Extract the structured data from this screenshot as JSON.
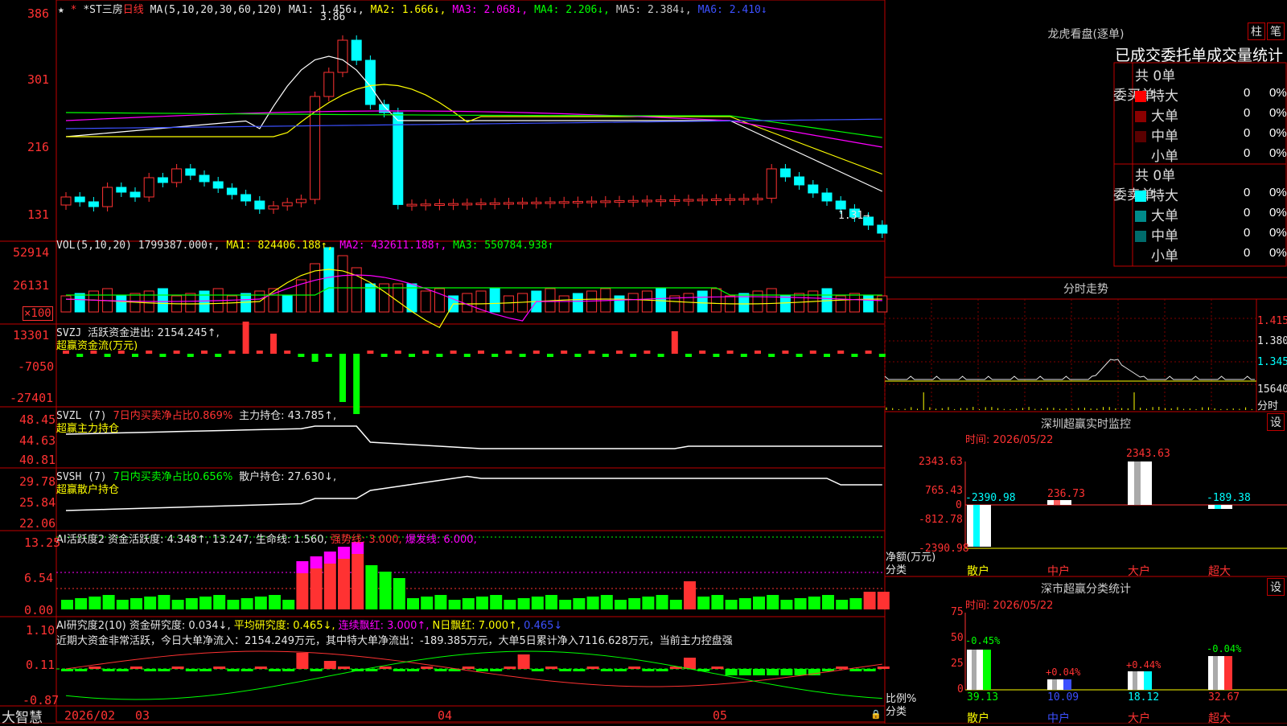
{
  "kline": {
    "stock": "*ST三房",
    "period": "日线",
    "ma_params": "MA(5,10,20,30,60,120)",
    "ma_values": [
      "MA1: 1.456↓,",
      "MA2: 1.666↓,",
      "MA3: 2.068↓,",
      "MA4: 2.206↓,",
      "MA5: 2.384↓,",
      "MA6: 2.410↓"
    ],
    "y_ticks": [
      "386",
      "301",
      "216",
      "131"
    ],
    "high_label": "3.86",
    "last_label": "1.31→"
  },
  "vol": {
    "head": [
      "VOL(5,10,20)",
      "1799387.000↑,",
      "MA1: 824406.188↑,",
      "MA2: 432611.188↑,",
      "MA3: 550784.938↑"
    ],
    "y_ticks": [
      "52914",
      "26131",
      "×100"
    ]
  },
  "svzj": {
    "head": [
      "SVZJ",
      "活跃资金进出: 2154.245↑,"
    ],
    "sub": "超赢资金流(万元)",
    "y_ticks": [
      "13301",
      "-7050",
      "-27401"
    ]
  },
  "svzl": {
    "head": [
      "SVZL (7)",
      "7日内买卖净占比0.869%",
      "主力持仓: 43.785↑,"
    ],
    "sub": "超赢主力持仓",
    "y_ticks": [
      "48.45",
      "44.63",
      "40.81"
    ]
  },
  "svsh": {
    "head": [
      "SVSH (7)",
      "7日内买卖净占比0.656%",
      "散户持仓: 27.630↓,"
    ],
    "sub": "超赢散户持仓",
    "y_ticks": [
      "29.78",
      "25.84",
      "22.06"
    ]
  },
  "ai1": {
    "head": [
      "AI活跃度2",
      "资金活跃度: 4.348↑,",
      "13.247,",
      "生命线: 1.560,",
      "强势线: 3.000,",
      "爆发线: 6.000,"
    ],
    "y_ticks": [
      "13.25",
      "6.54",
      "0.00"
    ]
  },
  "ai2": {
    "head": [
      "AI研究度2(10)",
      "资金研究度: 0.034↓,",
      "平均研究度: 0.465↓,",
      "连续飘红: 3.000↑,",
      "N日飘红: 7.000↑,",
      "0.465↓"
    ],
    "comment": "近期大资金非常活跃，今日大单净流入：2154.249万元，其中特大单净流出：-189.385万元，大单5日累计净入7116.628万元，当前主力控盘强",
    "y_ticks": [
      "1.10",
      "0.11",
      "-0.87"
    ]
  },
  "xaxis": {
    "brand": "大智慧",
    "labels": [
      "2026/02",
      "03",
      "04",
      "05"
    ]
  },
  "longhu": {
    "title": "龙虎看盘(逐单)",
    "btn1": "柱",
    "btn2": "笔",
    "subtitle": "已成交委托单成交量统计",
    "buy_side": "委买单",
    "sell_side": "委卖单",
    "buy_total": "共 0单",
    "sell_total": "共 0单",
    "buy_rows": [
      {
        "name": "特大",
        "count": "0",
        "pct": "0%",
        "color": "#ff0000"
      },
      {
        "name": "大单",
        "count": "0",
        "pct": "0%",
        "color": "#8b0000"
      },
      {
        "name": "中单",
        "count": "0",
        "pct": "0%",
        "color": "#5a0000"
      },
      {
        "name": "小单",
        "count": "0",
        "pct": "0%",
        "color": ""
      }
    ],
    "sell_rows": [
      {
        "name": "特大",
        "count": "0",
        "pct": "0%",
        "color": "#00ffff"
      },
      {
        "name": "大单",
        "count": "0",
        "pct": "0%",
        "color": "#008b8b"
      },
      {
        "name": "中单",
        "count": "0",
        "pct": "0%",
        "color": "#006b6b"
      },
      {
        "name": "小单",
        "count": "0",
        "pct": "0%",
        "color": ""
      }
    ]
  },
  "fenshi": {
    "title": "分时走势",
    "y_ticks": [
      "1.415",
      "1.380",
      "1.345"
    ],
    "vol_label": "15640",
    "foot": "分时"
  },
  "monitor": {
    "title": "深圳超赢实时监控",
    "btn": "设",
    "time": "时间: 2026/05/22",
    "y_ticks": [
      "2343.63",
      "765.43",
      "0",
      "-812.78",
      "-2390.98"
    ],
    "unit": "净额(万元)",
    "cat_label": "分类",
    "categories": [
      "散户",
      "中户",
      "大户",
      "超大"
    ],
    "values": [
      "-2390.98",
      "236.73",
      "2343.63",
      "-189.38"
    ]
  },
  "classify": {
    "title": "深市超赢分类统计",
    "btn": "设",
    "time": "时间: 2026/05/22",
    "y_ticks": [
      "75",
      "50",
      "25",
      "0"
    ],
    "unit": "比例%",
    "cat_label": "分类",
    "categories": [
      "散户",
      "中户",
      "大户",
      "超大"
    ],
    "values": [
      "39.13",
      "10.09",
      "18.12",
      "32.67"
    ],
    "changes": [
      "-0.45%",
      "+0.04%",
      "+0.44%",
      "-0.04%"
    ]
  }
}
